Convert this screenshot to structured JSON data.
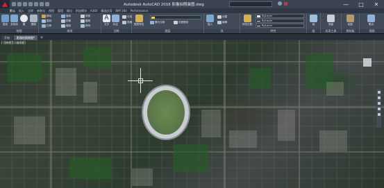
{
  "window": {
    "title": "Autodesk AutoCAD 2016    影像拍照装图.dwg",
    "controls": [
      "—",
      "□",
      "✕"
    ]
  },
  "ribbon_tabs": [
    "默认",
    "插入",
    "注释",
    "参数化",
    "视图",
    "管理",
    "输出",
    "附加模块",
    "A360",
    "精选应用",
    "BIM 360",
    "Performance"
  ],
  "ribbon": {
    "panels": {
      "draw": "绘图",
      "modify": "修改",
      "annotation": "注释",
      "layers": "图层",
      "block": "块",
      "properties": "特性",
      "groups": "组",
      "utilities": "实用工具",
      "clipboard": "剪贴板",
      "view": "视图"
    },
    "draw_tools": [
      "直线",
      "多段线",
      "圆",
      "圆弧"
    ],
    "modify_tools": [
      {
        "label": "移动",
        "icon": "move-icon"
      },
      {
        "label": "旋转",
        "icon": "rotate-icon"
      },
      {
        "label": "修剪",
        "icon": "trim-icon"
      },
      {
        "label": "复制",
        "icon": "copy-icon"
      },
      {
        "label": "镜像",
        "icon": "mirror-icon"
      },
      {
        "label": "圆角",
        "icon": "fillet-icon"
      },
      {
        "label": "拉伸",
        "icon": "stretch-icon"
      },
      {
        "label": "缩放",
        "icon": "scale-icon"
      },
      {
        "label": "阵列",
        "icon": "array-icon"
      }
    ],
    "annotation_tools": [
      "文字",
      "标注",
      "引线",
      "表格"
    ],
    "layer_tools": [
      "图层特性",
      "置为当前",
      "匹配图层"
    ],
    "block_tools": [
      "插入",
      "创建",
      "编辑"
    ],
    "properties_values": {
      "color": "ByLayer",
      "linetype": "ByLayer",
      "lineweight": "ByLayer"
    },
    "properties_tools": [
      "特性匹配"
    ],
    "group_tools": [
      "组"
    ],
    "utility_tools": [
      "测量"
    ],
    "clipboard_tools": [
      "粘贴"
    ],
    "view_tools": [
      "基点"
    ]
  },
  "file_tabs": {
    "items": [
      "开始",
      "影像拍照装图*"
    ],
    "active_index": 1,
    "add_label": "+"
  },
  "viewport": {
    "label": "[-][俯视][二维线框]"
  },
  "colors": {
    "titlebar": "#3b4453",
    "ribbon": "#414b58",
    "accent_red": "#d6262c"
  }
}
